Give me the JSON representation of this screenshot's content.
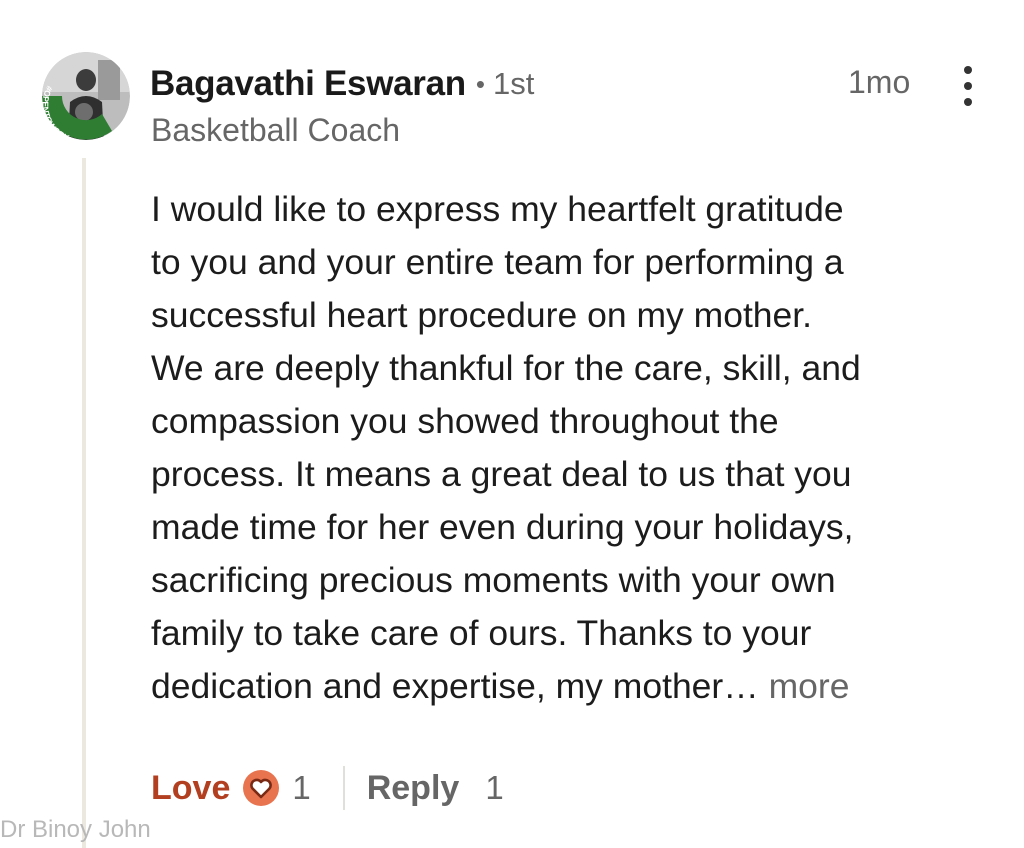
{
  "comment": {
    "author": {
      "name": "Bagavathi Eswaran",
      "separator": "•",
      "connection_degree": "1st",
      "headline": "Basketball Coach",
      "avatar_badge": "#OPENTOWORK"
    },
    "timestamp": "1mo",
    "menu_icon": "more-vertical-icon",
    "body_lines": [
      "I would like to express my heartfelt gratitude",
      "to you and your entire team for performing a",
      "successful heart procedure on my mother.",
      "We are deeply thankful for the care, skill, and",
      "compassion you showed throughout the",
      "process. It means a great deal to us that you",
      "made time for her even during your holidays,",
      "sacrificing precious moments with your own",
      "family to take care of ours. Thanks to your",
      "dedication and expertise, my mother…"
    ],
    "see_more": " more",
    "actions": {
      "reaction_label": "Love",
      "reaction_icon": "heart-icon",
      "reaction_count": "1",
      "reply_label": "Reply",
      "reply_count": "1"
    }
  },
  "watermark": "Dr Binoy John",
  "colors": {
    "love": "#b24020",
    "heart_fill": "#e8734f",
    "open_to_work_ring": "#2e7d32",
    "secondary_text": "#666666",
    "thread_line": "#ebe8df"
  }
}
